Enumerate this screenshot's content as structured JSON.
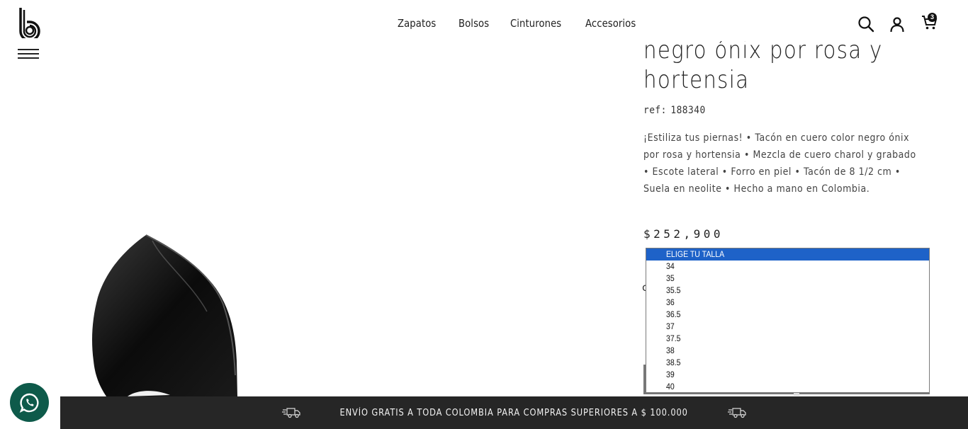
{
  "header": {
    "nav": [
      {
        "label": "Zapatos"
      },
      {
        "label": "Bolsos"
      },
      {
        "label": "Cinturones"
      },
      {
        "label": "Accesorios"
      }
    ],
    "cart_count": "3"
  },
  "product": {
    "title": "negro ónix por rosa y\nhortensia",
    "ref_label": "ref:",
    "ref_value": "188340",
    "description": "¡Estiliza tus piernas! • Tacón en cuero color negro ónix por rosa y hortensia • Mezcla de cuero charol y grabado • Escote lateral • Forro en piel • Tacón de 8 1/2 cm • Suela en neolite • Hecho a mano en Colombia.",
    "price": "$252,900"
  },
  "size_select": {
    "options": [
      "ELIGE TU TALLA",
      "34",
      "35",
      "35.5",
      "36",
      "36.5",
      "37",
      "37.5",
      "38",
      "38.5",
      "39",
      "40"
    ],
    "selected_index": 0
  },
  "shipping_bar": {
    "text": "ENVÍO GRATIS A TODA COLOMBIA PARA COMPRAS SUPERIORES A $ 100.000"
  },
  "colors": {
    "select_highlight": "#1e62c8",
    "shipbar_bg": "#262626",
    "whatsapp_bg": "#0e5a4a"
  },
  "icons": [
    "brand-logo",
    "menu-icon",
    "search-icon",
    "user-icon",
    "cart-icon",
    "whatsapp-icon",
    "truck-icon"
  ]
}
